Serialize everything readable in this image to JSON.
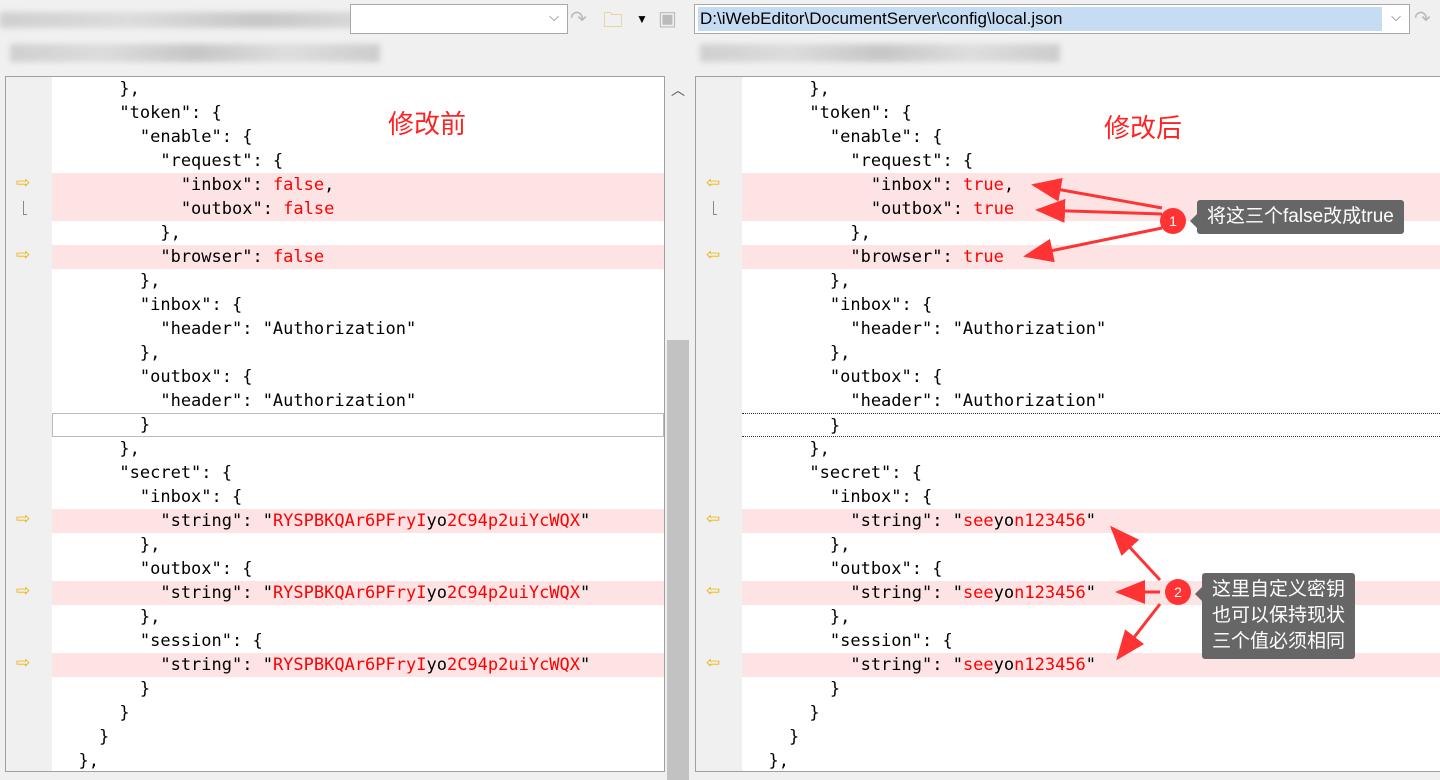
{
  "toolbar": {
    "right_path": "D:\\iWebEditor\\DocumentServer\\config\\local.json"
  },
  "annotations": {
    "before_label": "修改前",
    "after_label": "修改后",
    "callout1_num": "1",
    "callout1_text": "将这三个false改成true",
    "callout2_num": "2",
    "callout2_lines": [
      "这里自定义密钥",
      "也可以保持现状",
      "三个值必须相同"
    ]
  },
  "colors": {
    "diff_bg": "#fde3e3",
    "changed_text": "#ff0000",
    "gutter_arrow": "#e8b400"
  },
  "left_lines": [
    [
      [
        "      },",
        "k"
      ]
    ],
    [
      [
        "      \"token\": {",
        "k"
      ]
    ],
    [
      [
        "        \"enable\": {",
        "k"
      ]
    ],
    [
      [
        "          \"request\": {",
        "k"
      ]
    ],
    [
      [
        "            \"inbox\": ",
        "k"
      ],
      [
        "false",
        "r"
      ],
      [
        ",",
        "k"
      ]
    ],
    [
      [
        "            \"outbox\": ",
        "k"
      ],
      [
        "false",
        "r"
      ]
    ],
    [
      [
        "          },",
        "k"
      ]
    ],
    [
      [
        "          \"browser\": ",
        "k"
      ],
      [
        "false",
        "r"
      ]
    ],
    [
      [
        "        },",
        "k"
      ]
    ],
    [
      [
        "        \"inbox\": {",
        "k"
      ]
    ],
    [
      [
        "          \"header\": \"Authorization\"",
        "k"
      ]
    ],
    [
      [
        "        },",
        "k"
      ]
    ],
    [
      [
        "        \"outbox\": {",
        "k"
      ]
    ],
    [
      [
        "          \"header\": \"Authorization\"",
        "k"
      ]
    ],
    [
      [
        "        }",
        "k"
      ]
    ],
    [
      [
        "      },",
        "k"
      ]
    ],
    [
      [
        "      \"secret\": {",
        "k"
      ]
    ],
    [
      [
        "        \"inbox\": {",
        "k"
      ]
    ],
    [
      [
        "          \"string\": \"",
        "k"
      ],
      [
        "RYSPBKQAr6PFryI",
        "r"
      ],
      [
        "yo",
        "k"
      ],
      [
        "2C94p2uiYcWQX",
        "r"
      ],
      [
        "\"",
        "k"
      ]
    ],
    [
      [
        "        },",
        "k"
      ]
    ],
    [
      [
        "        \"outbox\": {",
        "k"
      ]
    ],
    [
      [
        "          \"string\": \"",
        "k"
      ],
      [
        "RYSPBKQAr6PFryI",
        "r"
      ],
      [
        "yo",
        "k"
      ],
      [
        "2C94p2uiYcWQX",
        "r"
      ],
      [
        "\"",
        "k"
      ]
    ],
    [
      [
        "        },",
        "k"
      ]
    ],
    [
      [
        "        \"session\": {",
        "k"
      ]
    ],
    [
      [
        "          \"string\": \"",
        "k"
      ],
      [
        "RYSPBKQAr6PFryI",
        "r"
      ],
      [
        "yo",
        "k"
      ],
      [
        "2C94p2uiYcWQX",
        "r"
      ],
      [
        "\"",
        "k"
      ]
    ],
    [
      [
        "        }",
        "k"
      ]
    ],
    [
      [
        "      }",
        "k"
      ]
    ],
    [
      [
        "    }",
        "k"
      ]
    ],
    [
      [
        "  },",
        "k"
      ]
    ]
  ],
  "right_lines": [
    [
      [
        "      },",
        "k"
      ]
    ],
    [
      [
        "      \"token\": {",
        "k"
      ]
    ],
    [
      [
        "        \"enable\": {",
        "k"
      ]
    ],
    [
      [
        "          \"request\": {",
        "k"
      ]
    ],
    [
      [
        "            \"inbox\": ",
        "k"
      ],
      [
        "true",
        "r"
      ],
      [
        ",",
        "k"
      ]
    ],
    [
      [
        "            \"outbox\": ",
        "k"
      ],
      [
        "true",
        "r"
      ]
    ],
    [
      [
        "          },",
        "k"
      ]
    ],
    [
      [
        "          \"browser\": ",
        "k"
      ],
      [
        "true",
        "r"
      ]
    ],
    [
      [
        "        },",
        "k"
      ]
    ],
    [
      [
        "        \"inbox\": {",
        "k"
      ]
    ],
    [
      [
        "          \"header\": \"Authorization\"",
        "k"
      ]
    ],
    [
      [
        "        },",
        "k"
      ]
    ],
    [
      [
        "        \"outbox\": {",
        "k"
      ]
    ],
    [
      [
        "          \"header\": \"Authorization\"",
        "k"
      ]
    ],
    [
      [
        "        }",
        "k"
      ]
    ],
    [
      [
        "      },",
        "k"
      ]
    ],
    [
      [
        "      \"secret\": {",
        "k"
      ]
    ],
    [
      [
        "        \"inbox\": {",
        "k"
      ]
    ],
    [
      [
        "          \"string\": \"",
        "k"
      ],
      [
        "see",
        "r"
      ],
      [
        "yo",
        "k"
      ],
      [
        "n123456",
        "r"
      ],
      [
        "\"",
        "k"
      ]
    ],
    [
      [
        "        },",
        "k"
      ]
    ],
    [
      [
        "        \"outbox\": {",
        "k"
      ]
    ],
    [
      [
        "          \"string\": \"",
        "k"
      ],
      [
        "see",
        "r"
      ],
      [
        "yo",
        "k"
      ],
      [
        "n123456",
        "r"
      ],
      [
        "\"",
        "k"
      ]
    ],
    [
      [
        "        },",
        "k"
      ]
    ],
    [
      [
        "        \"session\": {",
        "k"
      ]
    ],
    [
      [
        "          \"string\": \"",
        "k"
      ],
      [
        "see",
        "r"
      ],
      [
        "yo",
        "k"
      ],
      [
        "n123456",
        "r"
      ],
      [
        "\"",
        "k"
      ]
    ],
    [
      [
        "        }",
        "k"
      ]
    ],
    [
      [
        "      }",
        "k"
      ]
    ],
    [
      [
        "    }",
        "k"
      ]
    ],
    [
      [
        "  },",
        "k"
      ]
    ]
  ],
  "diff_rows": [
    4,
    5,
    7,
    18,
    21,
    24
  ],
  "gutter_arrow_rows": [
    4,
    7,
    18,
    21,
    24
  ]
}
